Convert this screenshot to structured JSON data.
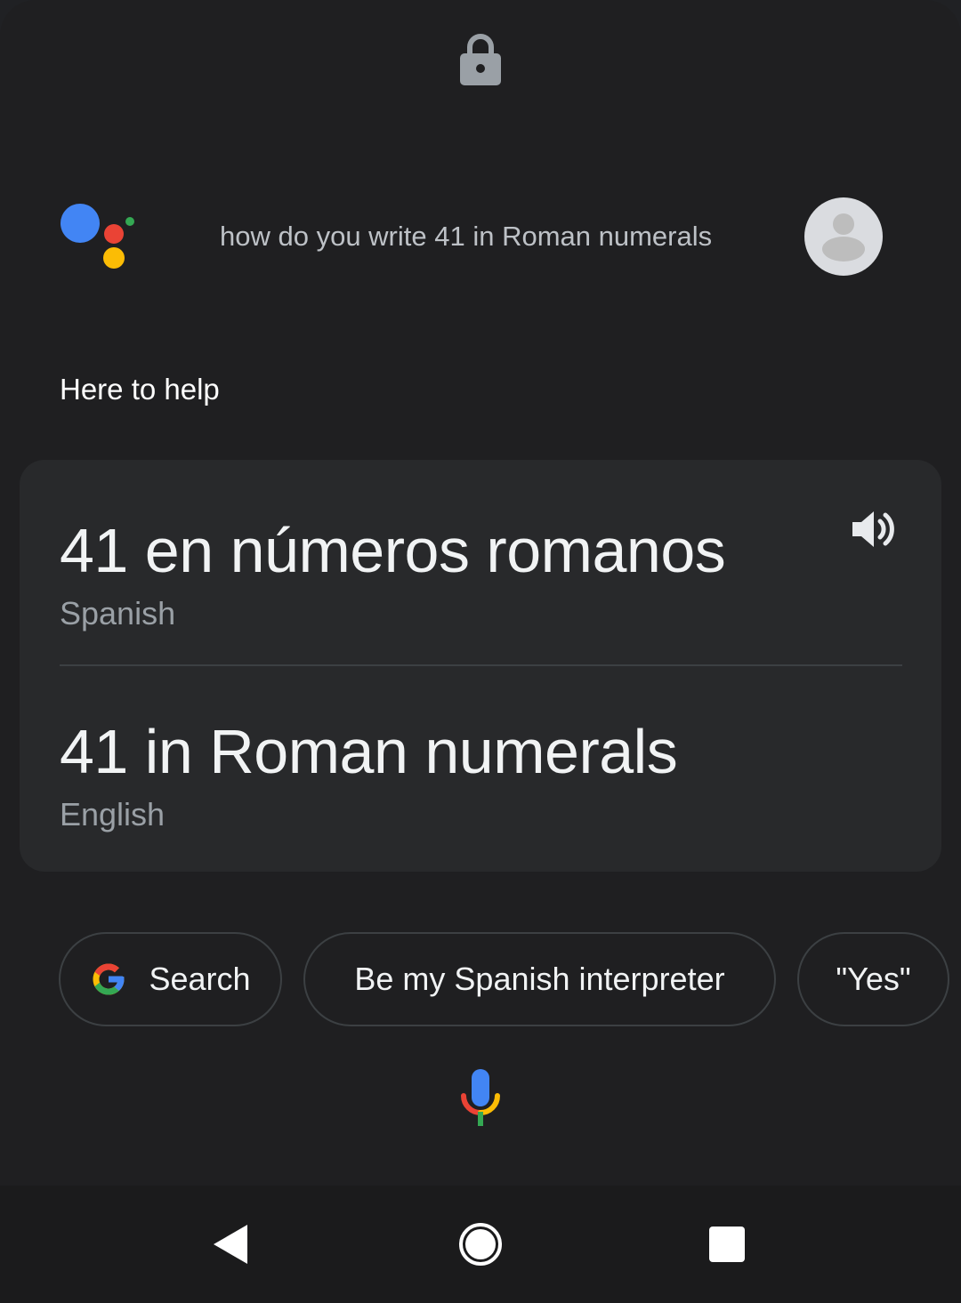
{
  "header": {
    "lock_icon": "lock-icon",
    "query_text": "how do you write 41 in Roman numerals"
  },
  "assistant": {
    "logo_colors": [
      "#4285f4",
      "#ea4335",
      "#fbbc05",
      "#34a853"
    ],
    "helper_text": "Here to help"
  },
  "translation_card": {
    "source": {
      "text": "41 en números romanos",
      "language": "Spanish"
    },
    "target": {
      "text": "41 in Roman numerals",
      "language": "English"
    },
    "speaker_icon": "volume-icon"
  },
  "suggestions": [
    {
      "label": "Search",
      "icon": "google-g-icon"
    },
    {
      "label": "Be my Spanish interpreter"
    },
    {
      "label": "\"Yes\""
    }
  ],
  "navigation": {
    "back": "back-icon",
    "home": "home-icon",
    "recents": "recents-icon"
  }
}
